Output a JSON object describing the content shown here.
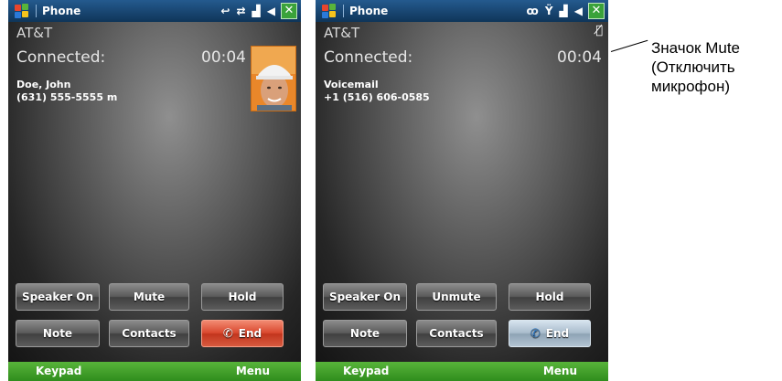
{
  "colors": {
    "titlebar": "#245a8e",
    "softkey_bar": "#3fa128",
    "end_button_active": "#d9482e",
    "end_button_disabled": "#a9bccc"
  },
  "phones": [
    {
      "app_title": "Phone",
      "status_icons": [
        "call-forward-icon",
        "sync-icon",
        "signal-icon",
        "speaker-icon"
      ],
      "carrier": "AT&T",
      "connected_label": "Connected:",
      "timer": "00:04",
      "caller_name": "Doe, John",
      "caller_number": "(631) 555-5555 m",
      "buttons": {
        "speaker": "Speaker On",
        "mute": "Mute",
        "hold": "Hold",
        "note": "Note",
        "contacts": "Contacts",
        "end": "End"
      },
      "softkeys": {
        "left": "Keypad",
        "right": "Menu"
      }
    },
    {
      "app_title": "Phone",
      "status_icons": [
        "voicemail-icon",
        "antenna-icon",
        "signal-icon",
        "speaker-icon"
      ],
      "carrier": "AT&T",
      "connected_label": "Connected:",
      "timer": "00:04",
      "caller_name": "Voicemail",
      "caller_number": "+1 (516) 606-0585",
      "buttons": {
        "speaker": "Speaker On",
        "mute": "Unmute",
        "hold": "Hold",
        "note": "Note",
        "contacts": "Contacts",
        "end": "End"
      },
      "softkeys": {
        "left": "Keypad",
        "right": "Menu"
      }
    }
  ],
  "callout": {
    "line1": "Значок Mute",
    "line2": "(Отключить",
    "line3": "микрофон)"
  }
}
